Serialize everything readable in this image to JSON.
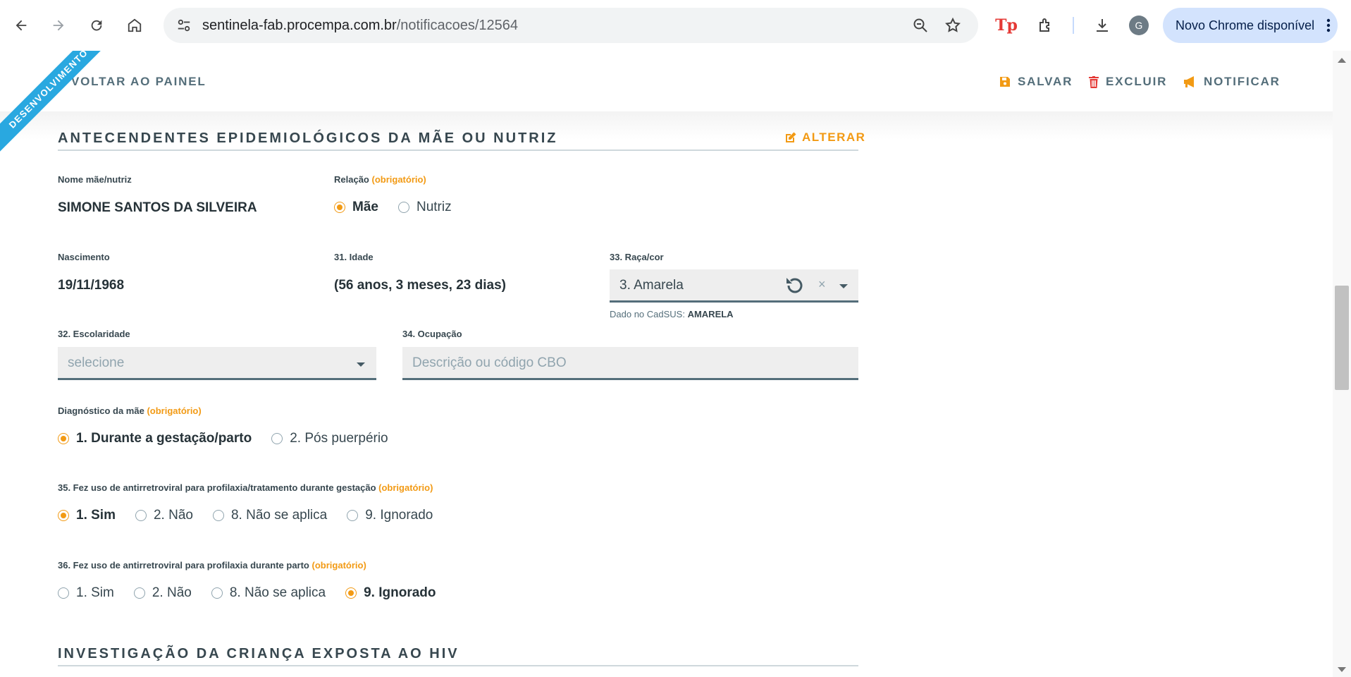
{
  "browser": {
    "url_domain": "sentinela-fab.procempa.com.br",
    "url_path": "/notificacoes/12564",
    "profile_initial": "G",
    "update_label": "Novo Chrome disponível",
    "extension_label": "Tp"
  },
  "header": {
    "ribbon": "DESENVOLVIMENTO",
    "back": "VOLTAR AO PAINEL",
    "save": "SALVAR",
    "delete": "EXCLUIR",
    "notify": "NOTIFICAR"
  },
  "colors": {
    "accent": "#f29a14",
    "ribbon": "#29a8e0",
    "text": "#37474f",
    "field_bg": "#eeeeee"
  },
  "section": {
    "title": "ANTECENDENTES EPIDEMIOLÓGICOS DA MÃE OU NUTRIZ",
    "edit": "ALTERAR",
    "next_title": "INVESTIGAÇÃO DA CRIANÇA EXPOSTA AO HIV"
  },
  "required": "(obrigatório)",
  "mother": {
    "name_label": "Nome mãe/nutriz",
    "name": "SIMONE SANTOS DA SILVEIRA",
    "relation_label": "Relação",
    "relation_options": [
      "Mãe",
      "Nutriz"
    ],
    "relation_selected": "Mãe",
    "birth_label": "Nascimento",
    "birth": "19/11/1968",
    "age_label": "31. Idade",
    "age": "(56 anos, 3 meses, 23 dias)",
    "race_label": "33. Raça/cor",
    "race_value": "3. Amarela",
    "cadsus_label": "Dado no CadSUS:",
    "cadsus_value": "AMARELA",
    "school_label": "32. Escolaridade",
    "school_placeholder": "selecione",
    "job_label": "34. Ocupação",
    "job_placeholder": "Descrição ou código CBO"
  },
  "diagnosis": {
    "label": "Diagnóstico da mãe",
    "options": [
      "1. Durante a gestação/parto",
      "2. Pós puerpério"
    ],
    "selected": 0
  },
  "q35": {
    "label": "35. Fez uso de antirretroviral para profilaxia/tratamento durante gestação",
    "options": [
      "1. Sim",
      "2. Não",
      "8. Não se aplica",
      "9. Ignorado"
    ],
    "selected": 0
  },
  "q36": {
    "label": "36. Fez uso de antirretroviral para profilaxia durante parto",
    "options": [
      "1. Sim",
      "2. Não",
      "8. Não se aplica",
      "9. Ignorado"
    ],
    "selected": 3
  }
}
